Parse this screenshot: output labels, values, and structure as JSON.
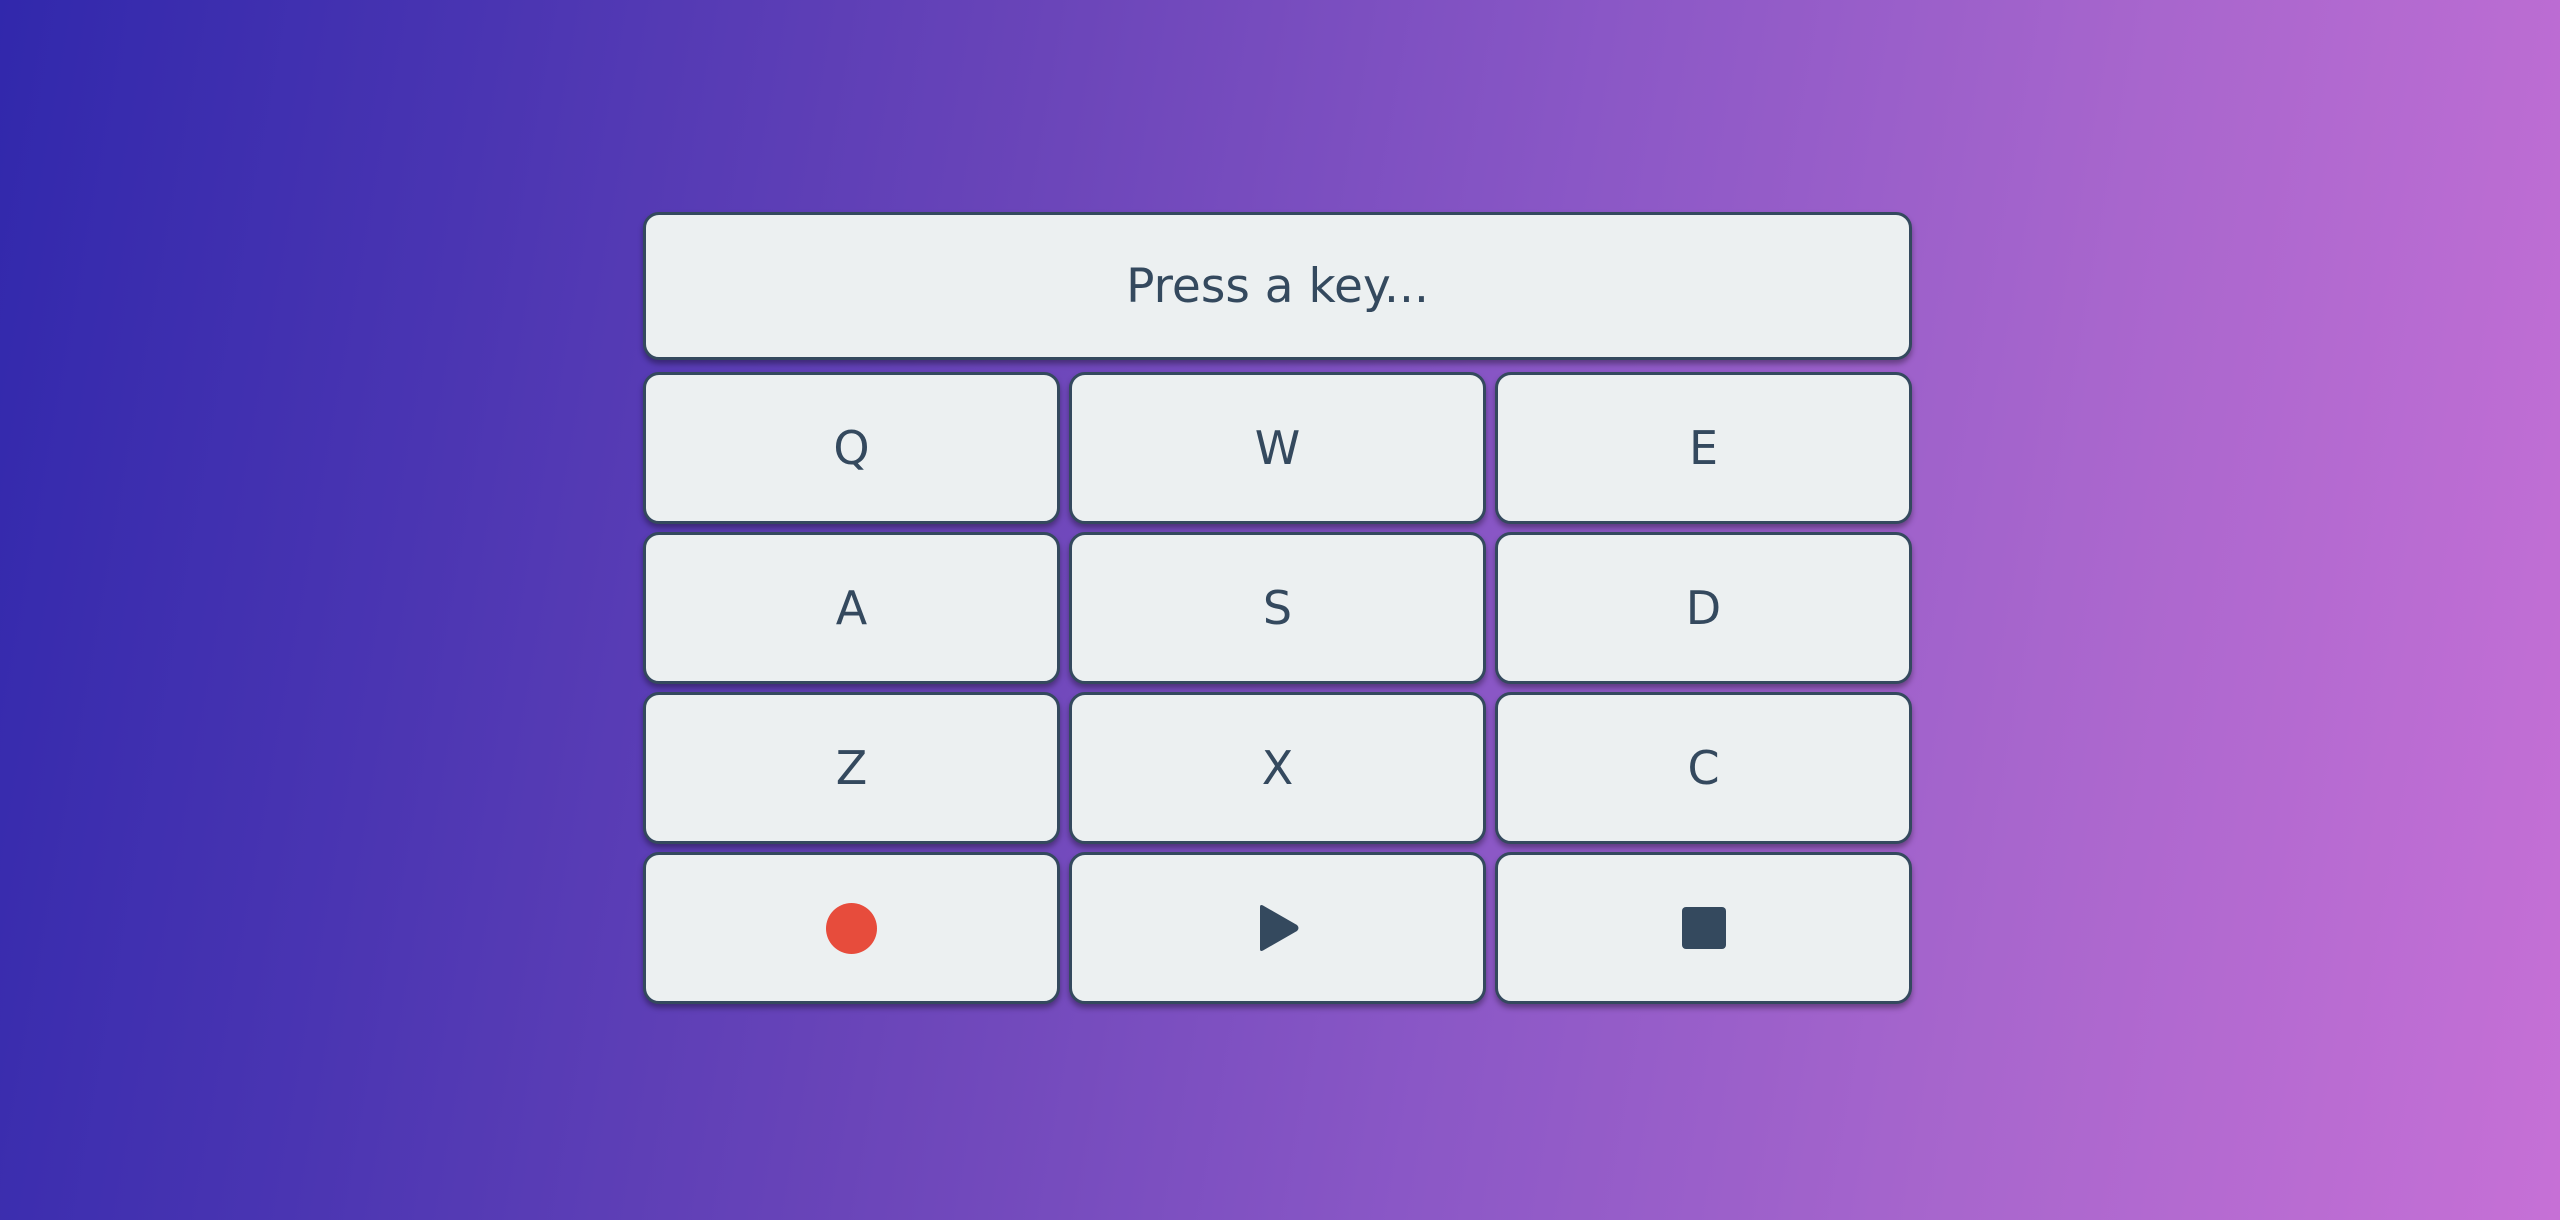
{
  "display": {
    "text": "Press a key..."
  },
  "keys": {
    "row1": [
      "Q",
      "W",
      "E"
    ],
    "row2": [
      "A",
      "S",
      "D"
    ],
    "row3": [
      "Z",
      "X",
      "C"
    ]
  },
  "controls": [
    {
      "name": "record",
      "icon": "record-icon",
      "color": "#e74c3c"
    },
    {
      "name": "play",
      "icon": "play-icon",
      "color": "#34495e"
    },
    {
      "name": "stop",
      "icon": "stop-icon",
      "color": "#34495e"
    }
  ],
  "colors": {
    "key_background": "#ecf0f1",
    "key_border": "#34495e",
    "text": "#34495e",
    "record": "#e74c3c",
    "gradient_start": "#3128ac",
    "gradient_end": "#c670d6"
  }
}
